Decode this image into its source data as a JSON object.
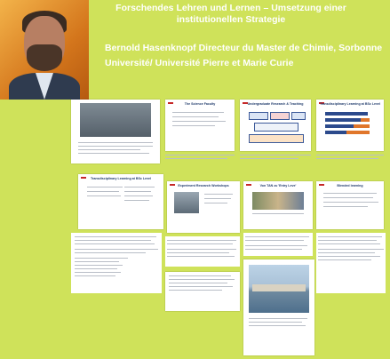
{
  "header": {
    "headline_line1": "Forschendes Lehren und Lernen – Umsetzung einer",
    "headline_line2": "institutionellen Strategie",
    "author_line1": "Bernold Hasenknopf Directeur du Master de Chimie, Sorbonne",
    "author_line2": "Université/ Université Pierre et Marie Curie"
  },
  "slides": {
    "s2_title": "The Science Faculty",
    "s3_title": "Undergraduate Research & Teaching",
    "s4_title": "Transdisciplinary Learning at BSc Level",
    "s5_title": "Transdisciplinary Learning at BSc Level",
    "s6_title": "Experiment Research Workshops",
    "s7_title": "Von TAN zu 'Entry Leve'",
    "s8_title": "Blended learning"
  },
  "colors": {
    "background": "#cfe25a",
    "accent": "#c62828",
    "slide_blue": "#1f3a6b"
  }
}
